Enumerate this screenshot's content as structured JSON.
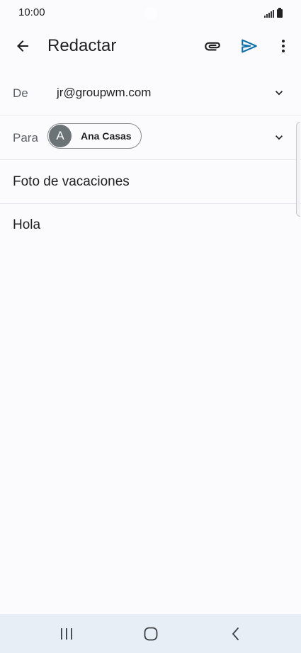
{
  "status_bar": {
    "time": "10:00"
  },
  "app_bar": {
    "title": "Redactar",
    "icons": {
      "back": "arrow-back-icon",
      "attach": "paperclip-icon",
      "send": "send-icon",
      "more": "more-vert-icon"
    },
    "send_color": "#0b6fa8"
  },
  "from": {
    "label": "De",
    "value": "jr@groupwm.com"
  },
  "to": {
    "label": "Para",
    "recipient": {
      "initial": "A",
      "name": "Ana Casas"
    }
  },
  "subject": {
    "value": "Foto de vacaciones"
  },
  "body": {
    "value": "Hola"
  },
  "nav_bar": {
    "icons": [
      "recents-icon",
      "home-icon",
      "back-icon"
    ]
  }
}
